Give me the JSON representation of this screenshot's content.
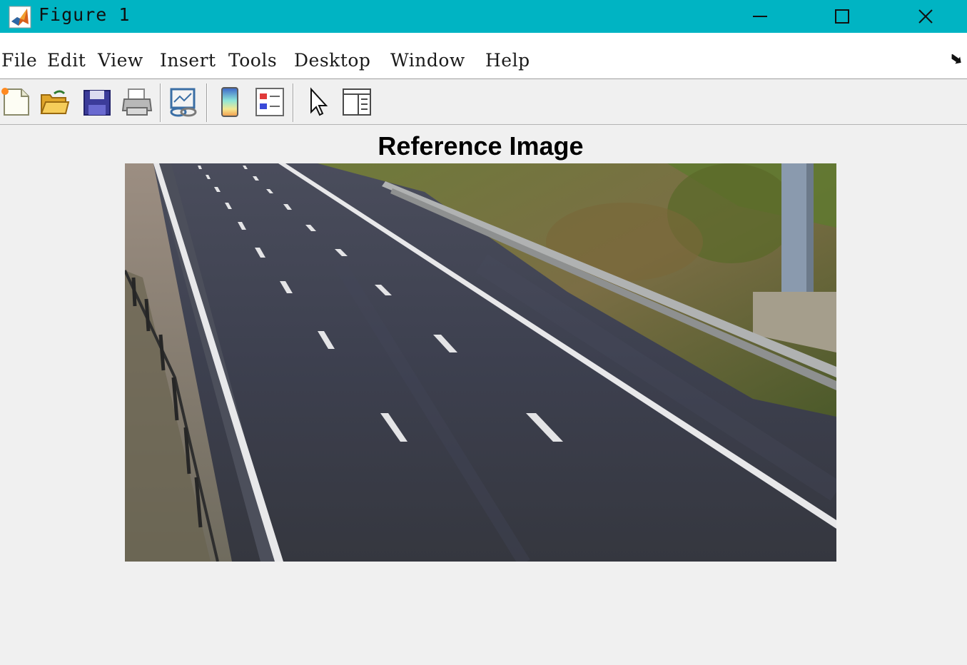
{
  "window": {
    "title": "Figure 1",
    "accent_color": "#00b4c3",
    "controls": [
      "minimize-icon",
      "maximize-icon",
      "close-icon"
    ]
  },
  "menubar": {
    "items": [
      {
        "label": "File"
      },
      {
        "label": "Edit"
      },
      {
        "label": "View"
      },
      {
        "label": "Insert"
      },
      {
        "label": "Tools"
      },
      {
        "label": "Desktop"
      },
      {
        "label": "Window"
      },
      {
        "label": "Help"
      }
    ],
    "dock_icon": "dock-arrow-icon"
  },
  "toolbar": {
    "buttons": [
      "new-figure-icon",
      "open-file-icon",
      "save-icon",
      "print-icon",
      "link-plot-icon",
      "insert-colorbar-icon",
      "insert-legend-icon",
      "edit-plot-icon",
      "property-inspector-icon"
    ]
  },
  "axes": {
    "title": "Reference Image",
    "content": "highway-road-image"
  }
}
